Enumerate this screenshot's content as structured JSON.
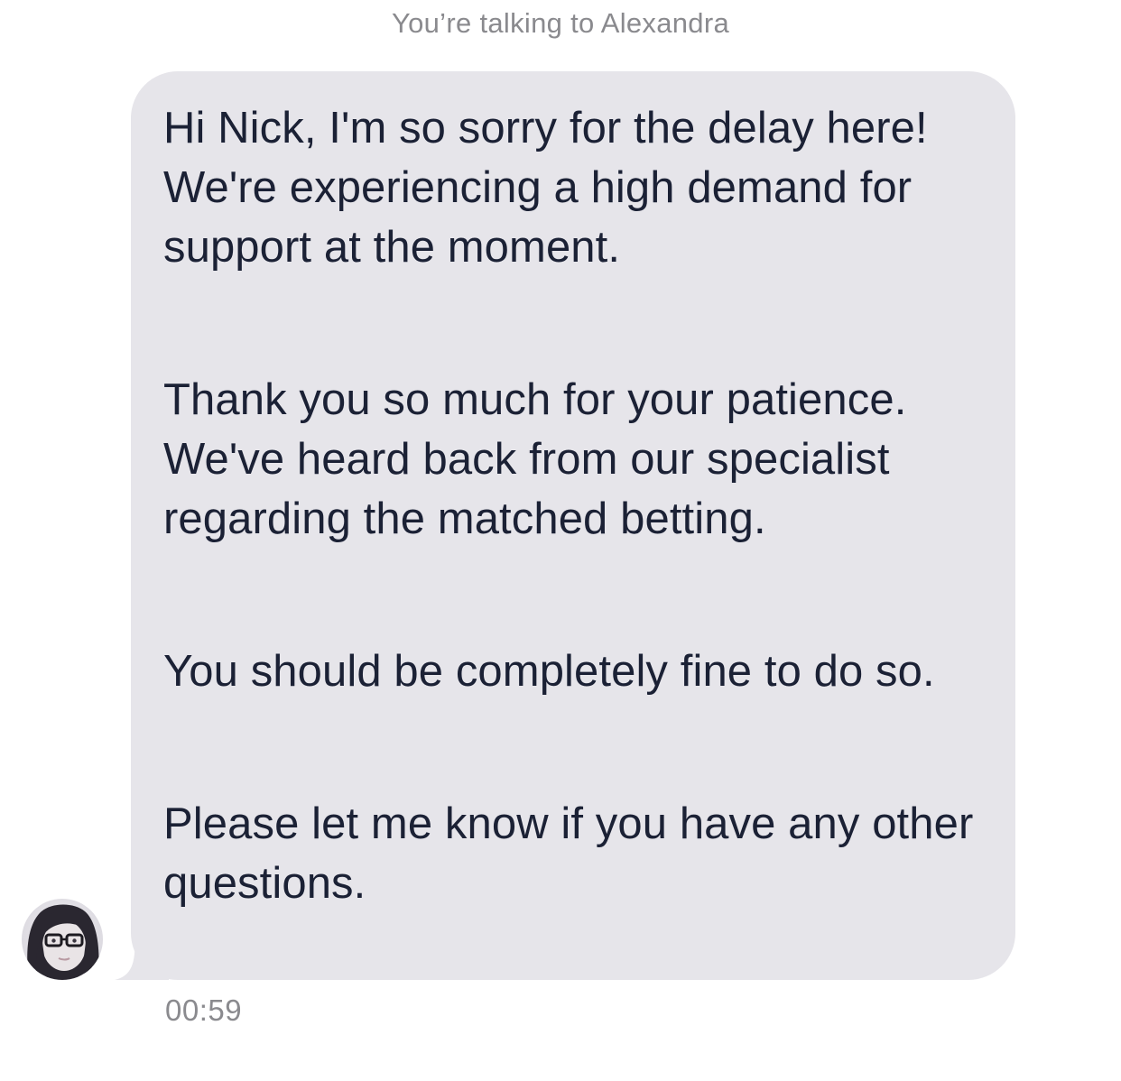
{
  "conversation": {
    "header": "You’re talking to Alexandra",
    "agent_name": "Alexandra",
    "message": {
      "paragraphs": [
        "Hi Nick, I'm so sorry for the delay here! We're experiencing a high demand for support at the moment.",
        "Thank you so much for your patience. We've heard back from our specialist regarding the matched betting.",
        "You should be completely fine to do so.",
        "Please let me know if you have any other questions."
      ],
      "time": "00:59"
    },
    "avatar_icon": "agent-avatar-photo",
    "colors": {
      "bubble": "#e6e5ea",
      "text": "#1b2135",
      "meta": "#8a8a8e"
    }
  }
}
